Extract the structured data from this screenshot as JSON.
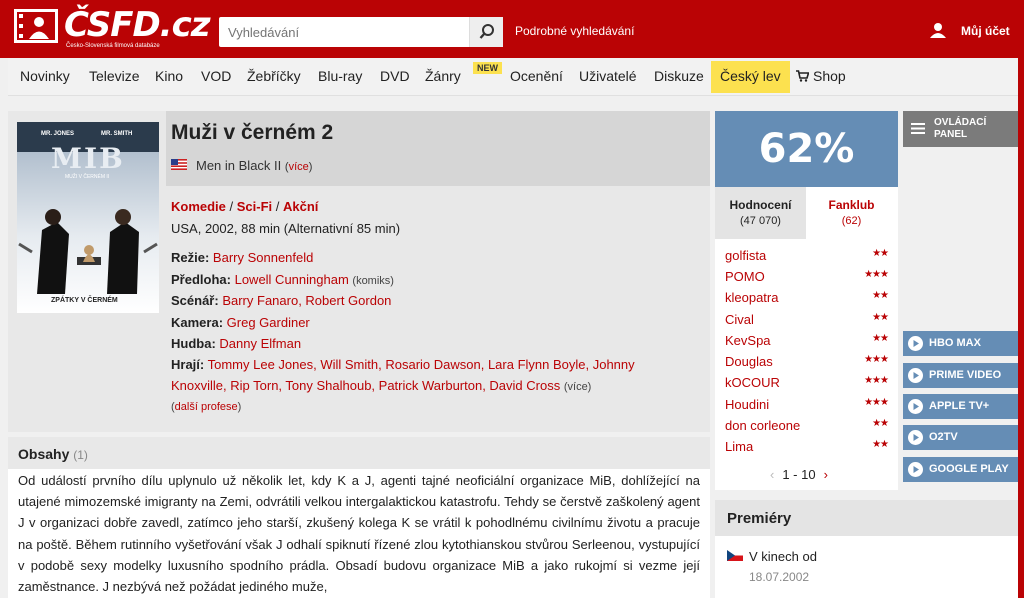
{
  "header": {
    "logo_text": "ČSFD.cz",
    "logo_subtitle": "Česko-Slovenská filmová databáze",
    "search_placeholder": "Vyhledávání",
    "advanced_search": "Podrobné vyhledávání",
    "account_label": "Můj účet"
  },
  "nav": {
    "items": [
      "Novinky",
      "Televize",
      "Kino",
      "VOD",
      "Žebříčky",
      "Blu-ray",
      "DVD",
      "Žánry",
      "Ocenění",
      "Uživatelé",
      "Diskuze",
      "Český lev",
      "Shop"
    ],
    "new_badge": "NEW"
  },
  "film": {
    "title": "Muži v černém 2",
    "original_title": "Men in Black II",
    "original_more": "více",
    "genres": [
      "Komedie",
      "Sci-Fi",
      "Akční"
    ],
    "genre_separator": " / ",
    "origin": "USA, 2002, 88 min (Alternativní 85 min)",
    "crew": {
      "directing_label": "Režie:",
      "directing": "Barry Sonnenfeld",
      "source_label": "Předloha:",
      "source": "Lowell Cunningham",
      "source_note": "(komiks)",
      "screenplay_label": "Scénář:",
      "screenplay": "Barry Fanaro, Robert Gordon",
      "camera_label": "Kamera:",
      "camera": "Greg Gardiner",
      "music_label": "Hudba:",
      "music": "Danny Elfman",
      "cast_label": "Hrají:",
      "cast_line1": "Tommy Lee Jones, Will Smith, Rosario Dawson, Lara Flynn Boyle, Johnny",
      "cast_line2": "Knoxville, Rip Torn, Tony Shalhoub, Patrick Warburton, David Cross",
      "cast_more": "(více)",
      "more_professions_open": "(",
      "more_professions": "další profese",
      "more_professions_close": ")"
    },
    "poster": {
      "actors_left": "MR. JONES",
      "actors_right": "MR. SMITH",
      "logo": "MIB",
      "subtitle": "MUŽI V ČERNÉM II",
      "tagline": "ZPÁTKY V ČERNÉM"
    }
  },
  "plot": {
    "title": "Obsahy",
    "count": "(1)",
    "text": "Od událostí prvního dílu uplynulo už několik let, kdy K a J, agenti tajné neoficiální organizace MiB, dohlížející na utajené mimozemské imigranty na Zemi, odvrátili velkou intergalaktickou katastrofu. Tehdy se čerstvě zaškolený agent J v organizaci dobře zavedl, zatímco jeho starší, zkušený kolega K se vrátil k pohodlnému civilnímu životu a pracuje na poště. Během rutinního vyšetřování však J odhalí spiknutí řízené zlou kytothianskou stvůrou Serleenou, vystupující v podobě sexy modelky luxusního spodního prádla. Obsadí budovu organizace MiB a jako rukojmí si vezme její zaměstnance. J nezbývá než požádat jediného muže,"
  },
  "rating": {
    "percent": "62%",
    "tab_ratings_label": "Hodnocení",
    "tab_ratings_count": "(47 070)",
    "tab_fanclub_label": "Fanklub",
    "tab_fanclub_count": "(62)",
    "users": [
      {
        "name": "golfista",
        "stars": "★★"
      },
      {
        "name": "POMO",
        "stars": "★★★"
      },
      {
        "name": "kleopatra",
        "stars": "★★"
      },
      {
        "name": "Cival",
        "stars": "★★"
      },
      {
        "name": "KevSpa",
        "stars": "★★"
      },
      {
        "name": "Douglas",
        "stars": "★★★"
      },
      {
        "name": "kOCOUR",
        "stars": "★★★"
      },
      {
        "name": "Houdini",
        "stars": "★★★"
      },
      {
        "name": "don corleone",
        "stars": "★★"
      },
      {
        "name": "Lima",
        "stars": "★★"
      }
    ],
    "pager": "1 - 10"
  },
  "sidebar": {
    "panel_label": "OVLÁDACÍ PANEL",
    "vod": [
      "HBO MAX",
      "PRIME VIDEO",
      "APPLE TV+",
      "O2TV",
      "GOOGLE PLAY"
    ]
  },
  "premieres": {
    "title": "Premiéry",
    "where": "V kinech od",
    "date": "18.07.2002"
  },
  "colors": {
    "brand_red": "#ba0305",
    "rating_blue": "#658db5",
    "highlight_yellow": "#fce14f"
  }
}
